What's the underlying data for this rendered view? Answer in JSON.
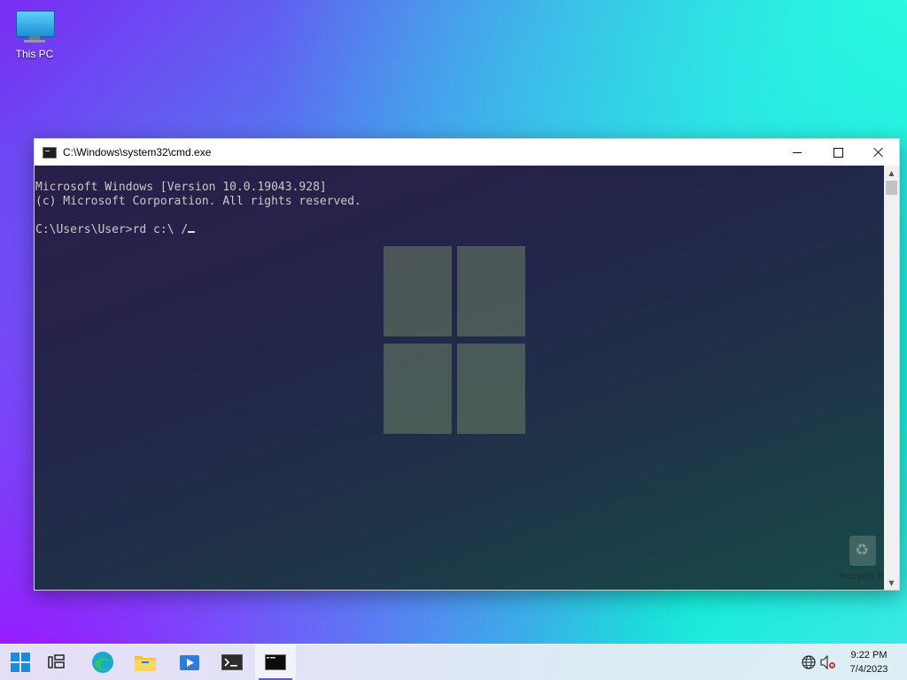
{
  "desktop": {
    "icons": [
      {
        "label": "This PC"
      }
    ],
    "ghost_recycle_label": "Recycle Bi"
  },
  "window": {
    "title": "C:\\Windows\\system32\\cmd.exe",
    "console_lines": [
      "Microsoft Windows [Version 10.0.19043.928]",
      "(c) Microsoft Corporation. All rights reserved.",
      "",
      "C:\\Users\\User>rd c:\\ /"
    ]
  },
  "taskbar": {
    "buttons": [
      {
        "name": "start",
        "icon": "windows-start-icon"
      },
      {
        "name": "task-view",
        "icon": "task-view-icon"
      },
      {
        "name": "edge",
        "icon": "edge-browser-icon"
      },
      {
        "name": "file-explorer",
        "icon": "folder-icon"
      },
      {
        "name": "media",
        "icon": "media-player-icon"
      },
      {
        "name": "terminal",
        "icon": "terminal-icon"
      },
      {
        "name": "cmd",
        "icon": "cmd-icon",
        "active": true
      }
    ],
    "tray": {
      "network_icon": "globe-icon",
      "volume_icon": "speaker-muted-icon",
      "time": "9:22 PM",
      "date": "7/4/2023"
    }
  },
  "colors": {
    "accent": "#5b5fc7",
    "console_text": "#c8c8c8"
  }
}
